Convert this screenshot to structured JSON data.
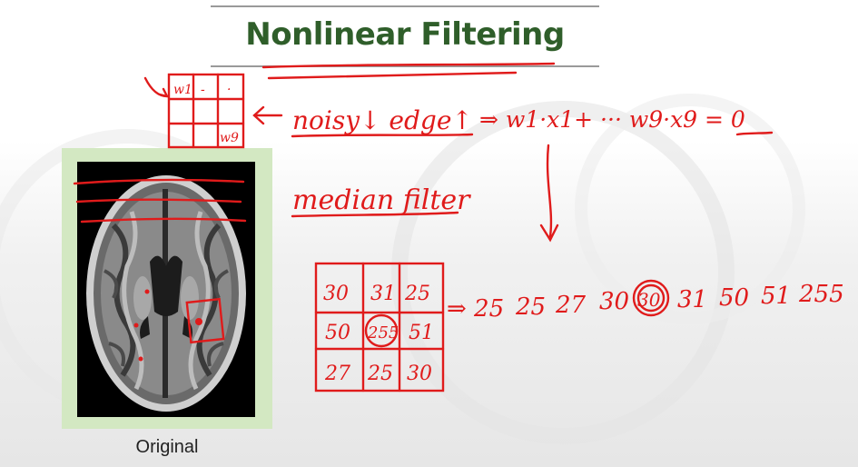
{
  "slide": {
    "title": "Nonlinear Filtering",
    "caption": "Original"
  },
  "annotations": {
    "kernel_cells": [
      "w1",
      "-",
      "·",
      "",
      "",
      "",
      "",
      "",
      "w9"
    ],
    "note_noisy": "noisy↓ edge↑",
    "note_equation": "⇒ w1·x1+ ··· w9·x9 = 0",
    "note_median": "median filter",
    "median_grid": [
      "30",
      "31",
      "25",
      "50",
      "255",
      "51",
      "27",
      "25",
      "30"
    ],
    "sorted_values": [
      "⇒ 25",
      "25",
      "27",
      "30",
      "30",
      "31",
      "50",
      "51",
      "255"
    ]
  },
  "colors": {
    "title": "#2f5e2a",
    "ink": "#e01b1b",
    "frame": "#d3e8c2"
  }
}
